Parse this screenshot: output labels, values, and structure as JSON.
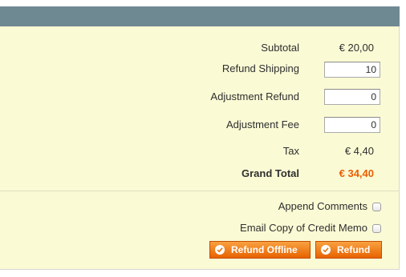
{
  "totals": {
    "subtotal_label": "Subtotal",
    "subtotal_value": "€ 20,00",
    "refund_shipping_label": "Refund Shipping",
    "refund_shipping_value": "10",
    "adjustment_refund_label": "Adjustment Refund",
    "adjustment_refund_value": "0",
    "adjustment_fee_label": "Adjustment Fee",
    "adjustment_fee_value": "0",
    "tax_label": "Tax",
    "tax_value": "€ 4,40",
    "grand_total_label": "Grand Total",
    "grand_total_value": "€ 34,40"
  },
  "options": {
    "append_comments_label": "Append Comments",
    "append_comments_checked": false,
    "email_copy_label": "Email Copy of Credit Memo",
    "email_copy_checked": false
  },
  "actions": {
    "refund_offline_label": "Refund Offline",
    "refund_label": "Refund",
    "button_icon": "check-circle-icon"
  },
  "colors": {
    "header_bar": "#6f8992",
    "panel_bg": "#fafad5",
    "grand_total": "#eb5e00",
    "button": "#f28a1d"
  }
}
